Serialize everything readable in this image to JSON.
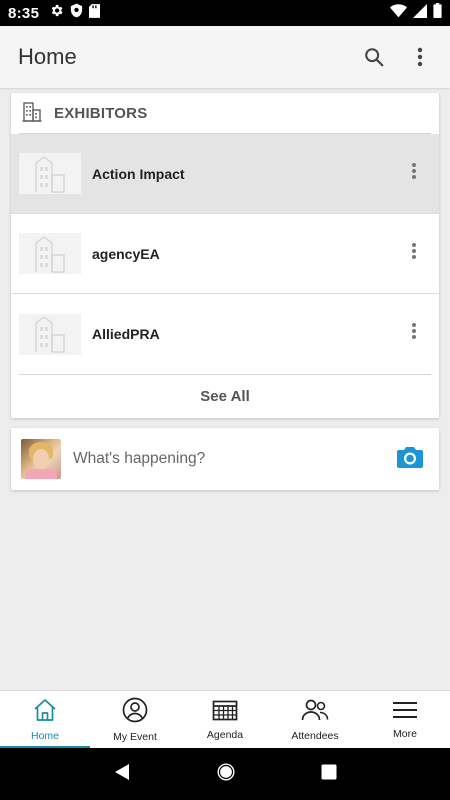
{
  "status_bar": {
    "time": "8:35",
    "icons": [
      "gear-icon",
      "shield-icon",
      "sd-card-icon",
      "wifi-icon",
      "signal-icon",
      "battery-icon"
    ]
  },
  "app_bar": {
    "title": "Home",
    "actions": [
      "search-icon",
      "overflow-menu-icon"
    ]
  },
  "exhibitors": {
    "header": "EXHIBITORS",
    "items": [
      {
        "name": "Action Impact",
        "selected": true
      },
      {
        "name": "agencyEA",
        "selected": false
      },
      {
        "name": "AlliedPRA",
        "selected": false
      }
    ],
    "see_all": "See All"
  },
  "composer": {
    "placeholder": "What's happening?"
  },
  "bottom_nav": {
    "items": [
      {
        "label": "Home",
        "icon": "home-icon",
        "active": true
      },
      {
        "label": "My Event",
        "icon": "person-circle-icon",
        "active": false
      },
      {
        "label": "Agenda",
        "icon": "calendar-grid-icon",
        "active": false
      },
      {
        "label": "Attendees",
        "icon": "people-icon",
        "active": false
      },
      {
        "label": "More",
        "icon": "hamburger-icon",
        "active": false
      }
    ]
  },
  "colors": {
    "accent": "#1a8aa6",
    "camera": "#1b95d3"
  }
}
